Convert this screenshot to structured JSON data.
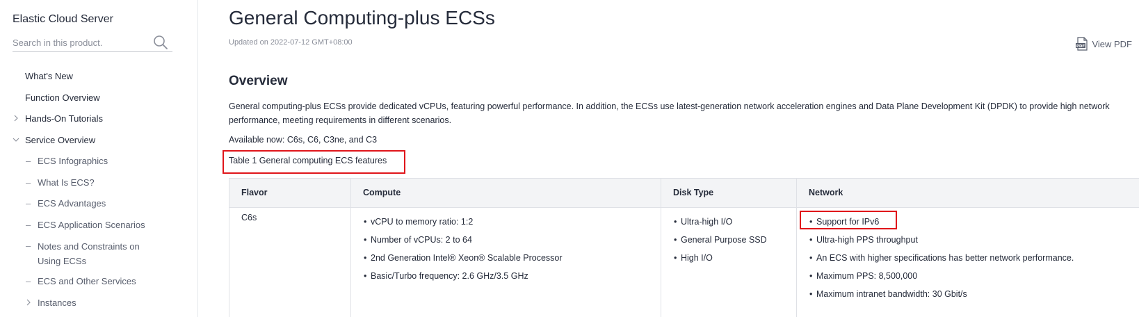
{
  "sidebar": {
    "product_title": "Elastic Cloud Server",
    "search_placeholder": "Search in this product.",
    "items": [
      {
        "label": "What's New"
      },
      {
        "label": "Function Overview"
      },
      {
        "label": "Hands-On Tutorials"
      },
      {
        "label": "Service Overview"
      },
      {
        "label": "ECS Infographics"
      },
      {
        "label": "What Is ECS?"
      },
      {
        "label": "ECS Advantages"
      },
      {
        "label": "ECS Application Scenarios"
      },
      {
        "label": "Notes and Constraints on Using ECSs"
      },
      {
        "label": "ECS and Other Services"
      },
      {
        "label": "Instances"
      }
    ]
  },
  "main": {
    "title": "General Computing-plus ECSs",
    "updated": "Updated on 2022-07-12 GMT+08:00",
    "view_pdf": "View PDF",
    "overview_heading": "Overview",
    "overview_text": "General computing-plus ECSs provide dedicated vCPUs, featuring powerful performance. In addition, the ECSs use latest-generation network acceleration engines and Data Plane Development Kit (DPDK) to provide high network performance, meeting requirements in different scenarios.",
    "available_now": "Available now: C6s, C6, C3ne, and C3",
    "table_caption": "Table 1 General computing ECS features",
    "table": {
      "headers": [
        "Flavor",
        "Compute",
        "Disk Type",
        "Network"
      ],
      "rows": [
        {
          "flavor": "C6s",
          "compute": [
            "vCPU to memory ratio: 1:2",
            "Number of vCPUs: 2 to 64",
            "2nd Generation Intel® Xeon® Scalable Processor",
            "Basic/Turbo frequency: 2.6 GHz/3.5 GHz"
          ],
          "disk": [
            "Ultra-high I/O",
            "General Purpose SSD",
            "High I/O"
          ],
          "network": [
            "Support for IPv6",
            "Ultra-high PPS throughput",
            "An ECS with higher specifications has better network performance.",
            "Maximum PPS: 8,500,000",
            "Maximum intranet bandwidth: 30 Gbit/s"
          ]
        }
      ]
    }
  },
  "colors": {
    "highlight_box": "#e0151a",
    "header_bg": "#f3f4f6",
    "text": "#252b3a",
    "muted": "#8a8e99"
  }
}
